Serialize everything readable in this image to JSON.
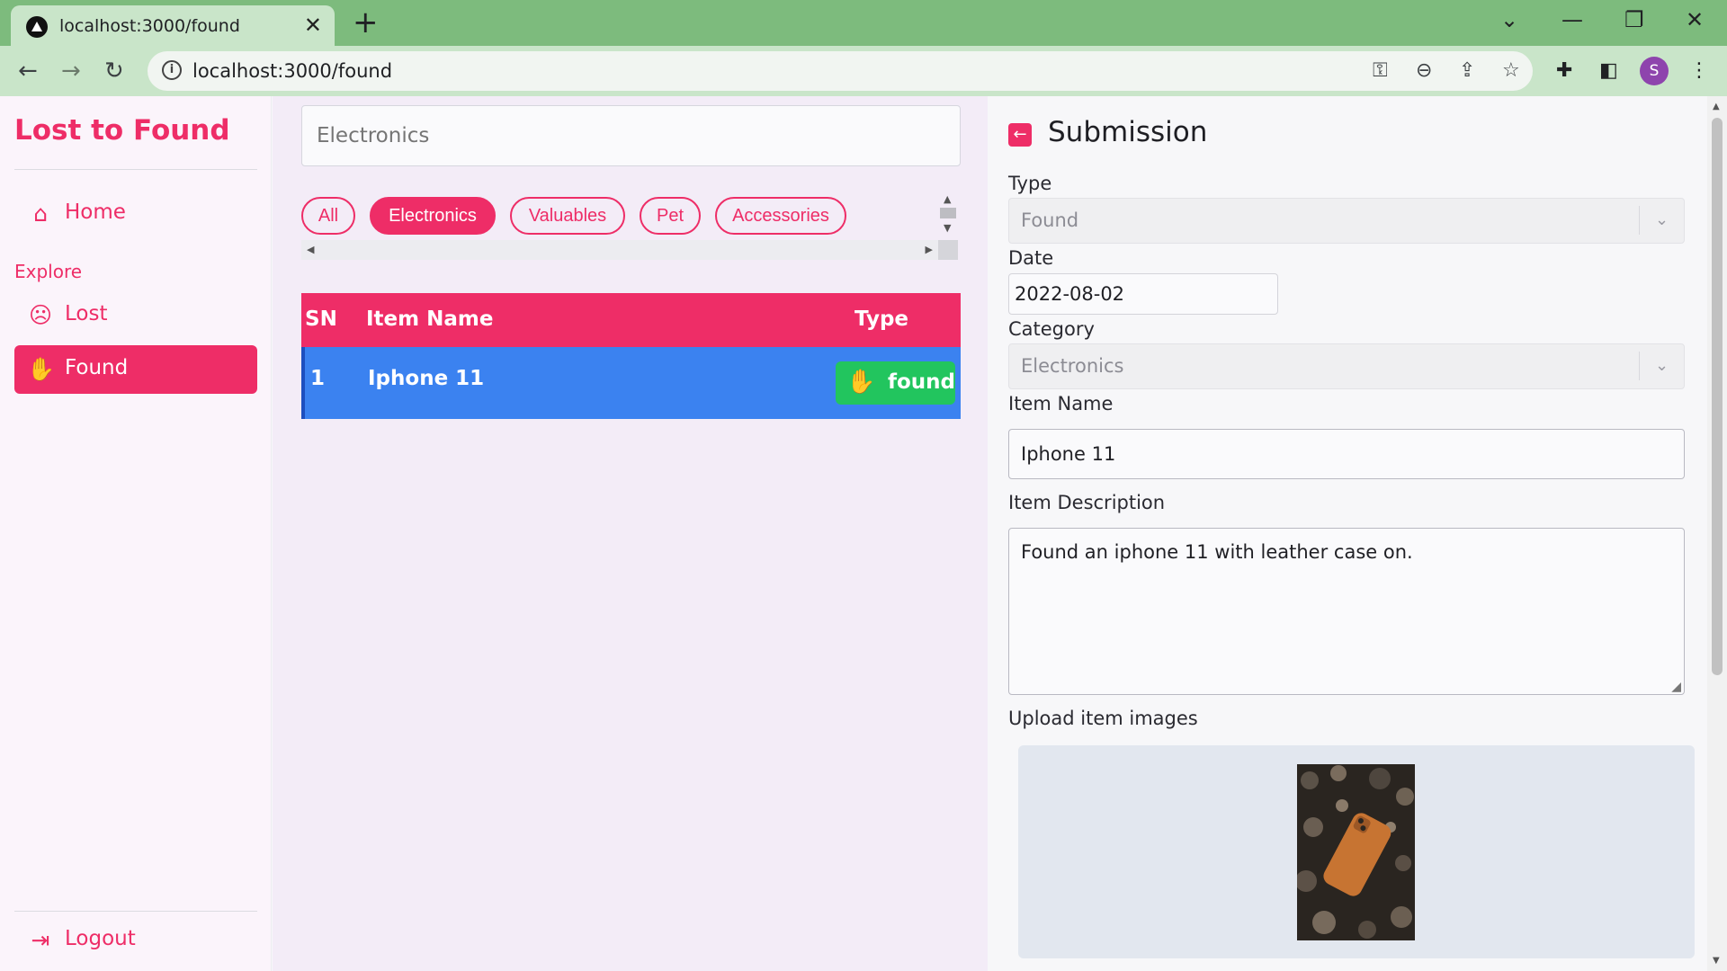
{
  "browser": {
    "tab_title": "localhost:3000/found",
    "url": "localhost:3000/found",
    "profile_initial": "S",
    "icons": [
      "back-arrow-icon",
      "forward-arrow-icon",
      "reload-icon",
      "info-icon",
      "key-icon",
      "zoom-out-icon",
      "share-icon",
      "star-icon",
      "puzzle-icon",
      "side-panel-icon",
      "kebab-menu-icon"
    ]
  },
  "sidebar": {
    "brand": "Lost to Found",
    "home_label": "Home",
    "section_label": "Explore",
    "lost_label": "Lost",
    "found_label": "Found",
    "logout_label": "Logout"
  },
  "center": {
    "search_placeholder": "Electronics",
    "chips": [
      "All",
      "Electronics",
      "Valuables",
      "Pet",
      "Accessories"
    ],
    "active_chip": "Electronics",
    "table": {
      "headers": {
        "sn": "SN",
        "item_name": "Item Name",
        "type": "Type"
      },
      "rows": [
        {
          "sn": "1",
          "item_name": "Iphone 11",
          "type": "found"
        }
      ]
    }
  },
  "submission": {
    "title": "Submission",
    "type_label": "Type",
    "type_value": "Found",
    "date_label": "Date",
    "date_value": "2022-08-02",
    "category_label": "Category",
    "category_value": "Electronics",
    "item_name_label": "Item Name",
    "item_name_value": "Iphone 11",
    "description_label": "Item Description",
    "description_value": "Found an iphone 11 with leather case on.",
    "upload_label": "Upload item images"
  },
  "colors": {
    "accent": "#ee2d67",
    "selected_row": "#3b82f0",
    "found_badge": "#22c55e",
    "chrome_green": "#7dbb7d"
  }
}
